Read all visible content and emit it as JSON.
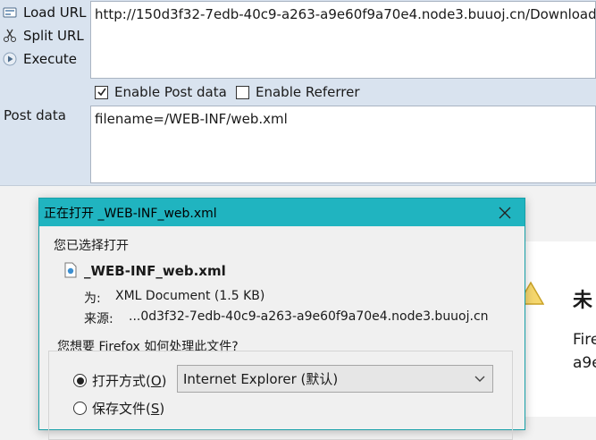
{
  "hackbar": {
    "load_url_label": "Load URL",
    "split_url_label": "Split URL",
    "execute_label": "Execute",
    "url_value": "http://150d3f32-7edb-40c9-a263-a9e60f9a70e4.node3.buuoj.cn/Download",
    "enable_post_label": "Enable Post data",
    "enable_post_checked": true,
    "enable_referrer_label": "Enable Referrer",
    "enable_referrer_checked": false,
    "post_data_label": "Post data",
    "post_data_value": "filename=/WEB-INF/web.xml"
  },
  "background_page": {
    "title_fragment": "未",
    "line1": "Fire",
    "line2": "a9e"
  },
  "dialog": {
    "title": "正在打开 _WEB-INF_web.xml",
    "chosen_label": "您已选择打开",
    "file_name": "_WEB-INF_web.xml",
    "type_label": "为:",
    "type_value": "XML Document (1.5 KB)",
    "source_label": "来源:",
    "source_value": "...0d3f32-7edb-40c9-a263-a9e60f9a70e4.node3.buuoj.cn",
    "question": "您想要 Firefox 如何处理此文件?",
    "open_with_label": "打开方式(",
    "open_with_key": "O",
    "open_with_selected": true,
    "app_selected": "Internet Explorer (默认)",
    "save_label": "保存文件(",
    "save_key": "S",
    "save_selected": false,
    "close_paren": ")"
  }
}
